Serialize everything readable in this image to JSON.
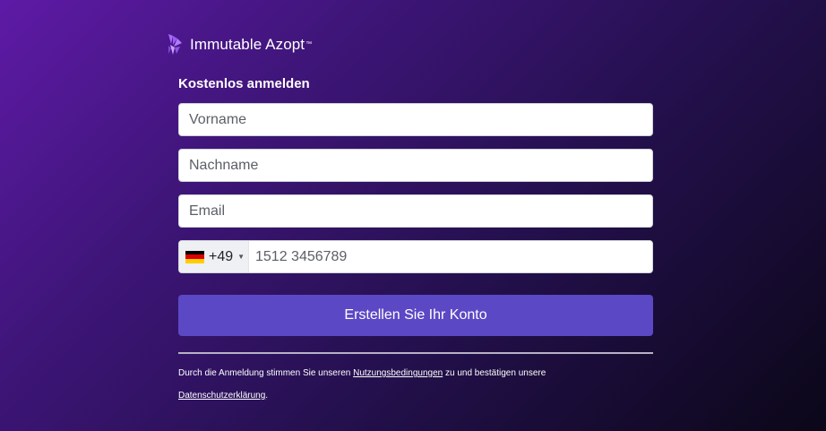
{
  "brand": {
    "name": "Immutable Azopt",
    "trademark": "™",
    "logo_icon": "fan-logo-icon",
    "logo_color": "#a86bff"
  },
  "form": {
    "heading": "Kostenlos anmelden",
    "first_name": {
      "placeholder": "Vorname",
      "value": ""
    },
    "last_name": {
      "placeholder": "Nachname",
      "value": ""
    },
    "email": {
      "placeholder": "Email",
      "value": ""
    },
    "phone": {
      "country_flag": "germany-flag-icon",
      "dial_code": "+49",
      "placeholder": "1512 3456789"
    },
    "submit_label": "Erstellen Sie Ihr Konto"
  },
  "terms": {
    "prefix": "Durch die Anmeldung stimmen Sie unseren ",
    "terms_link": "Nutzungsbedingungen",
    "middle": " zu und bestätigen unsere ",
    "privacy_link": "Datenschutzerklärung",
    "suffix": "."
  },
  "colors": {
    "button": "#5b48c4",
    "background_start": "#5e1aa6",
    "background_end": "#0b0718"
  }
}
